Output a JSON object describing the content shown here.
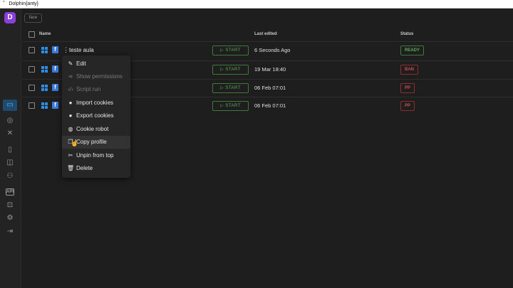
{
  "window": {
    "title": "Dolphin{anty}",
    "app_glyph": "ˆ"
  },
  "sidebar": {
    "logo": "D",
    "items": [
      {
        "name": "profiles-icon"
      },
      {
        "name": "chat-icon"
      },
      {
        "name": "proxy-icon"
      },
      {
        "name": "bookmark-icon"
      },
      {
        "name": "extensions-icon"
      },
      {
        "name": "team-icon"
      },
      {
        "name": "api-icon",
        "label": "API"
      },
      {
        "name": "scripts-icon"
      },
      {
        "name": "settings-icon"
      },
      {
        "name": "logout-icon"
      }
    ]
  },
  "search": {
    "value": "face"
  },
  "table": {
    "headers": {
      "name": "Name",
      "last_edited": "Last edited",
      "status": "Status"
    },
    "start_label": "▷  START",
    "rows": [
      {
        "name": "teste aula",
        "last_edited": "6 Seconds Ago",
        "status": "READY",
        "status_type": "ready"
      },
      {
        "name": "",
        "last_edited": "19 Mar 18:40",
        "status": "BAN",
        "status_type": "ban"
      },
      {
        "name": "",
        "last_edited": "06 Feb 07:01",
        "status": "PP",
        "status_type": "pp"
      },
      {
        "name": "",
        "last_edited": "06 Feb 07:01",
        "status": "PP",
        "status_type": "pp"
      }
    ]
  },
  "context_menu": {
    "items": [
      {
        "label": "Edit",
        "icon": "edit-icon",
        "disabled": false
      },
      {
        "label": "Show permissions",
        "icon": "share-icon",
        "disabled": true
      },
      {
        "label": "Script run",
        "icon": "code-icon",
        "disabled": true
      },
      {
        "label": "Import cookies",
        "icon": "cookie-icon",
        "disabled": false
      },
      {
        "label": "Export cookies",
        "icon": "cookie-icon",
        "disabled": false
      },
      {
        "label": "Cookie robot",
        "icon": "cookie-robot-icon",
        "disabled": false
      },
      {
        "label": "Copy profile",
        "icon": "copy-icon",
        "disabled": false
      },
      {
        "label": "Unpin from top",
        "icon": "unpin-icon",
        "disabled": false
      },
      {
        "label": "Delete",
        "icon": "trash-icon",
        "disabled": false
      }
    ]
  },
  "colors": {
    "accent_purple": "#8b3fd9",
    "active_nav": "#1f4c6e",
    "ready_green": "#5fae5a",
    "ban_red": "#d24a4a"
  }
}
